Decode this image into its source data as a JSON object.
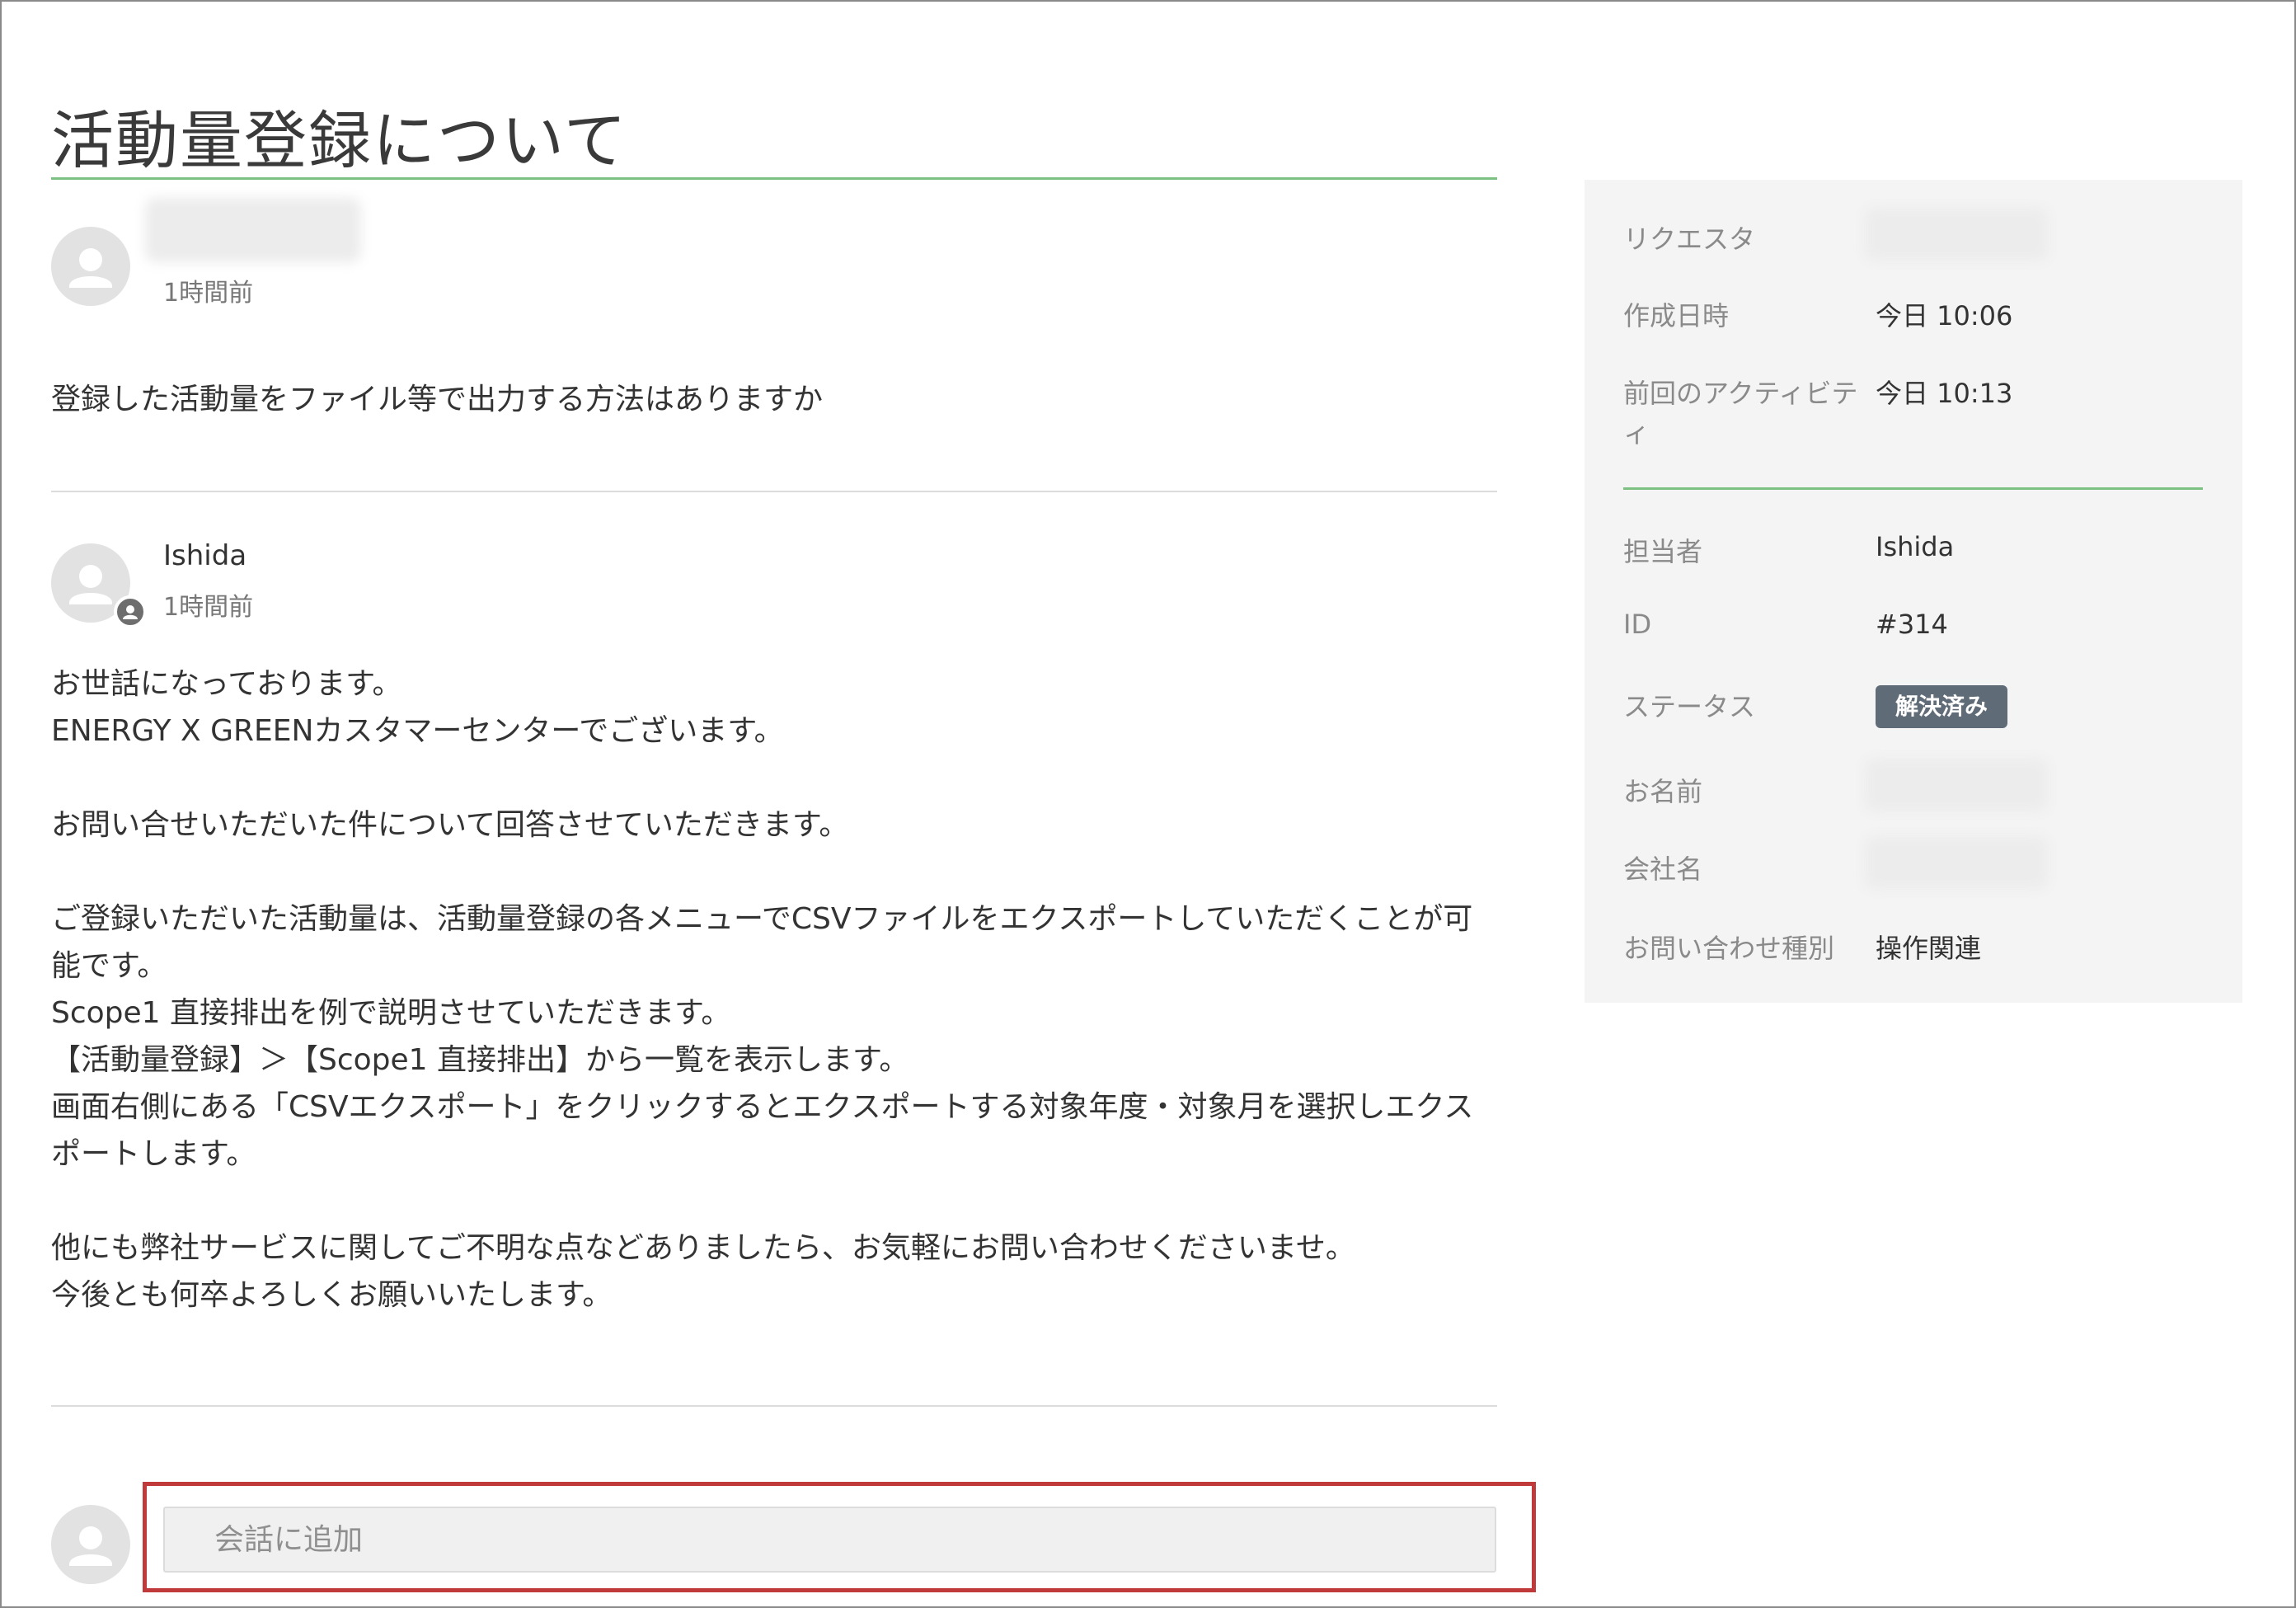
{
  "page": {
    "title": "活動量登録について"
  },
  "conversation": {
    "messages": [
      {
        "author": "",
        "time": "1時間前",
        "body": [
          "登録した活動量をファイル等で出力する方法はありますか"
        ]
      },
      {
        "author": "Ishida",
        "time": "1時間前",
        "body": [
          "お世話になっております。",
          "ENERGY X GREENカスタマーセンターでございます。",
          "",
          "お問い合せいただいた件について回答させていただきます。",
          "",
          "ご登録いただいた活動量は、活動量登録の各メニューでCSVファイルをエクスポートしていただくことが可",
          "能です。",
          "Scope1 直接排出を例で説明させていただきます。",
          "【活動量登録】＞【Scope1 直接排出】から一覧を表示します。",
          "画面右側にある「CSVエクスポート」をクリックするとエクスポートする対象年度・対象月を選択しエクス",
          "ポートします。",
          "",
          "他にも弊社サービスに関してご不明な点などありましたら、お気軽にお問い合わせくださいませ。",
          "今後とも何卒よろしくお願いいたします。"
        ]
      }
    ],
    "reply": {
      "placeholder": "会話に追加"
    }
  },
  "sidebar": {
    "requester_label": "リクエスタ",
    "created_label": "作成日時",
    "created_value": "今日 10:06",
    "last_activity_label_1": "前回のアクティビテ",
    "last_activity_label_2": "ィ",
    "last_activity_value": "今日 10:13",
    "assignee_label": "担当者",
    "assignee_value": "Ishida",
    "id_label": "ID",
    "id_value": "#314",
    "status_label": "ステータス",
    "status_value": "解決済み",
    "name_label": "お名前",
    "company_label": "会社名",
    "inquiry_type_label": "お問い合わせ種別",
    "inquiry_type_value": "操作関連"
  },
  "colors": {
    "accent_green": "#7cc082",
    "status_badge": "#5f6b77",
    "highlight_red": "#c0393b"
  }
}
